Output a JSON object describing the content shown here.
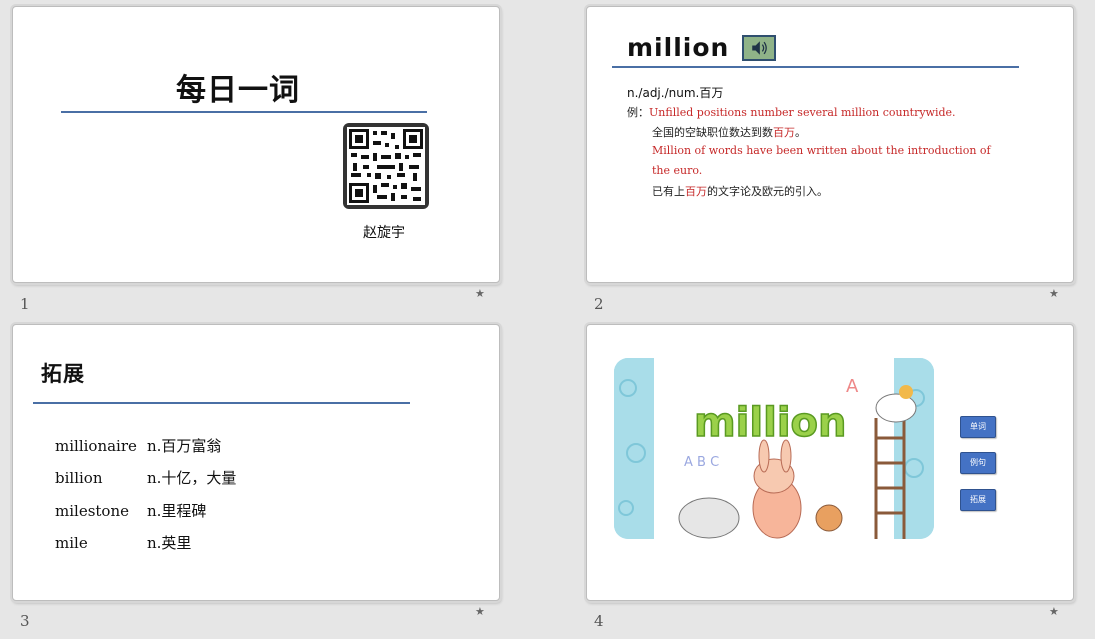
{
  "slides": [
    {
      "number": "1",
      "title": "每日一词",
      "author": "赵旋宇"
    },
    {
      "number": "2",
      "word": "million",
      "pos": "n./adj./num.百万",
      "example_label": "例：",
      "ex1_en": "Unfilled positions number several million countrywide.",
      "ex1_cn_a": "全国的空缺职位数达到数",
      "ex1_cn_hl": "百万",
      "ex1_cn_b": "。",
      "ex2_en_1": "Million of words have been written about the introduction of",
      "ex2_en_2": "the euro.",
      "ex2_cn_a": "已有上",
      "ex2_cn_hl": "百万",
      "ex2_cn_b": "的文字论及欧元的引入。"
    },
    {
      "number": "3",
      "title": "拓展",
      "vocab": [
        {
          "word": "millionaire",
          "meaning": "n.百万富翁"
        },
        {
          "word": "billion",
          "meaning": "n.十亿，大量"
        },
        {
          "word": "milestone",
          "meaning": "n.里程碑"
        },
        {
          "word": "mile",
          "meaning": "n.英里"
        }
      ]
    },
    {
      "number": "4",
      "image_word": "million",
      "image_letters": "A B C",
      "buttons": [
        "单词",
        "例句",
        "拓展"
      ]
    }
  ],
  "colors": {
    "accent_rule": "#4a6fa5",
    "example_red": "#c62828",
    "button_blue": "#4472c4"
  },
  "icons": {
    "star": "star-icon",
    "speaker": "speaker-icon"
  }
}
